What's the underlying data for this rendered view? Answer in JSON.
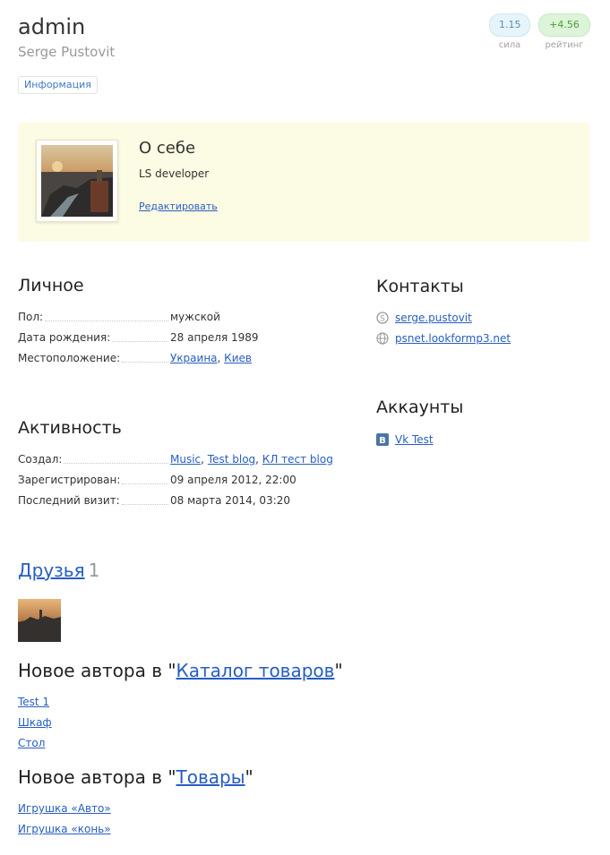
{
  "profile": {
    "username": "admin",
    "realname": "Serge Pustovit",
    "tab_info": "Информация",
    "power_value": "1.15",
    "power_label": "сила",
    "rating_value": "+4.56",
    "rating_label": "рейтинг"
  },
  "about": {
    "title": "О себе",
    "text": "LS developer",
    "edit_label": "Редактировать"
  },
  "personal": {
    "title": "Личное",
    "rows": [
      {
        "label": "Пол:",
        "value": "мужской"
      },
      {
        "label": "Дата рождения:",
        "value": "28 апреля 1989"
      },
      {
        "label": "Местоположение:",
        "country": "Украина",
        "sep": ", ",
        "city": "Киев"
      }
    ]
  },
  "contacts": {
    "title": "Контакты",
    "items": [
      {
        "icon": "skype-icon",
        "label": "serge.pustovit"
      },
      {
        "icon": "globe-icon",
        "label": "psnet.lookformp3.net"
      }
    ]
  },
  "accounts": {
    "title": "Аккаунты",
    "items": [
      {
        "icon": "vk-icon",
        "label": "Vk Test"
      }
    ]
  },
  "activity": {
    "title": "Активность",
    "rows": [
      {
        "label": "Создал:",
        "blogs": [
          "Music",
          "Test blog",
          "КЛ тест blog"
        ],
        "sep": ", "
      },
      {
        "label": "Зарегистрирован:",
        "value": "09 апреля 2012, 22:00"
      },
      {
        "label": "Последний визит:",
        "value": "08 марта 2014, 03:20"
      }
    ]
  },
  "friends": {
    "title": "Друзья",
    "count": "1"
  },
  "catalog_section": {
    "prefix": "Новое автора в \"",
    "link": "Каталог товаров",
    "suffix": "\"",
    "items": [
      "Test 1",
      "Шкаф",
      "Стол"
    ]
  },
  "goods_section": {
    "prefix": "Новое автора в \"",
    "link": "Товары",
    "suffix": "\"",
    "items": [
      "Игрушка «Авто»",
      "Игрушка «конь»"
    ]
  },
  "colors": {
    "link": "#275ec2",
    "about_bg": "#fcfbe3",
    "power_bg": "#e6f4fb",
    "rating_bg": "#ddf4d8"
  }
}
